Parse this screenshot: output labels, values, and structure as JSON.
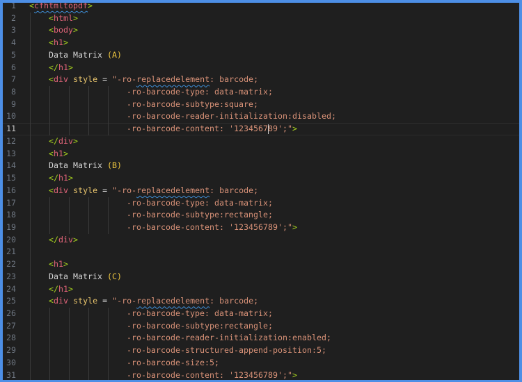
{
  "editor": {
    "current_line": 11,
    "cursor_after_text": "-ro-barcode-content: '1234567",
    "colors": {
      "border": "#4d8fe6",
      "background": "#1f1f1f",
      "bracket": "#a6d11f",
      "tag": "#e2657a",
      "attribute": "#e8c46c",
      "string": "#d99278",
      "text": "#d4d4d4",
      "paren": "#f2c940"
    },
    "lines": [
      {
        "n": "1",
        "tokens": [
          [
            "p",
            "<"
          ],
          [
            "t warn",
            "cfhtmltopdf"
          ],
          [
            "p",
            ">"
          ]
        ]
      },
      {
        "n": "2",
        "tokens": [
          [
            "x",
            "    "
          ],
          [
            "p",
            "<"
          ],
          [
            "t",
            "html"
          ],
          [
            "p",
            ">"
          ]
        ]
      },
      {
        "n": "3",
        "tokens": [
          [
            "x",
            "    "
          ],
          [
            "p",
            "<"
          ],
          [
            "t",
            "body"
          ],
          [
            "p",
            ">"
          ]
        ]
      },
      {
        "n": "4",
        "tokens": [
          [
            "x",
            "    "
          ],
          [
            "p",
            "<"
          ],
          [
            "t",
            "h1"
          ],
          [
            "p",
            ">"
          ]
        ]
      },
      {
        "n": "5",
        "tokens": [
          [
            "x",
            "    Data Matrix "
          ],
          [
            "b",
            "(A)"
          ]
        ]
      },
      {
        "n": "6",
        "tokens": [
          [
            "x",
            "    "
          ],
          [
            "p",
            "</"
          ],
          [
            "t",
            "h1"
          ],
          [
            "p",
            ">"
          ]
        ]
      },
      {
        "n": "7",
        "tokens": [
          [
            "x",
            "    "
          ],
          [
            "p",
            "<"
          ],
          [
            "t",
            "div"
          ],
          [
            "x",
            " "
          ],
          [
            "a",
            "style"
          ],
          [
            "o",
            " = "
          ],
          [
            "s",
            "\"-ro-"
          ],
          [
            "s warn",
            "replacedelement"
          ],
          [
            "s",
            ": barcode;"
          ]
        ]
      },
      {
        "n": "8",
        "tokens": [
          [
            "x",
            "                    "
          ],
          [
            "s",
            "-ro-barcode-type: data-matrix;"
          ]
        ]
      },
      {
        "n": "9",
        "tokens": [
          [
            "x",
            "                    "
          ],
          [
            "s",
            "-ro-barcode-subtype:square;"
          ]
        ]
      },
      {
        "n": "10",
        "tokens": [
          [
            "x",
            "                    "
          ],
          [
            "s",
            "-ro-barcode-reader-initialization:disabled;"
          ]
        ]
      },
      {
        "n": "11",
        "tokens": [
          [
            "x",
            "                    "
          ],
          [
            "s",
            "-ro-barcode-content: '1234567"
          ],
          [
            "cursor",
            ""
          ],
          [
            "s",
            "89';\""
          ],
          [
            "p",
            ">"
          ]
        ]
      },
      {
        "n": "12",
        "tokens": [
          [
            "x",
            "    "
          ],
          [
            "p",
            "</"
          ],
          [
            "t",
            "div"
          ],
          [
            "p",
            ">"
          ]
        ]
      },
      {
        "n": "13",
        "tokens": [
          [
            "x",
            "    "
          ],
          [
            "p",
            "<"
          ],
          [
            "t",
            "h1"
          ],
          [
            "p",
            ">"
          ]
        ]
      },
      {
        "n": "14",
        "tokens": [
          [
            "x",
            "    Data Matrix "
          ],
          [
            "b",
            "(B)"
          ]
        ]
      },
      {
        "n": "15",
        "tokens": [
          [
            "x",
            "    "
          ],
          [
            "p",
            "</"
          ],
          [
            "t",
            "h1"
          ],
          [
            "p",
            ">"
          ]
        ]
      },
      {
        "n": "16",
        "tokens": [
          [
            "x",
            "    "
          ],
          [
            "p",
            "<"
          ],
          [
            "t",
            "div"
          ],
          [
            "x",
            " "
          ],
          [
            "a",
            "style"
          ],
          [
            "o",
            " = "
          ],
          [
            "s",
            "\"-ro-"
          ],
          [
            "s warn",
            "replacedelement"
          ],
          [
            "s",
            ": barcode;"
          ]
        ]
      },
      {
        "n": "17",
        "tokens": [
          [
            "x",
            "                    "
          ],
          [
            "s",
            "-ro-barcode-type: data-matrix;"
          ]
        ]
      },
      {
        "n": "18",
        "tokens": [
          [
            "x",
            "                    "
          ],
          [
            "s",
            "-ro-barcode-subtype:rectangle;"
          ]
        ]
      },
      {
        "n": "19",
        "tokens": [
          [
            "x",
            "                    "
          ],
          [
            "s",
            "-ro-barcode-content: '123456789';\""
          ],
          [
            "p",
            ">"
          ]
        ]
      },
      {
        "n": "20",
        "tokens": [
          [
            "x",
            "    "
          ],
          [
            "p",
            "</"
          ],
          [
            "t",
            "div"
          ],
          [
            "p",
            ">"
          ]
        ]
      },
      {
        "n": "21",
        "tokens": [
          [
            "x",
            "    "
          ]
        ]
      },
      {
        "n": "22",
        "tokens": [
          [
            "x",
            "    "
          ],
          [
            "p",
            "<"
          ],
          [
            "t",
            "h1"
          ],
          [
            "p",
            ">"
          ]
        ]
      },
      {
        "n": "23",
        "tokens": [
          [
            "x",
            "    Data Matrix "
          ],
          [
            "b",
            "(C)"
          ]
        ]
      },
      {
        "n": "24",
        "tokens": [
          [
            "x",
            "    "
          ],
          [
            "p",
            "</"
          ],
          [
            "t",
            "h1"
          ],
          [
            "p",
            ">"
          ]
        ]
      },
      {
        "n": "25",
        "tokens": [
          [
            "x",
            "    "
          ],
          [
            "p",
            "<"
          ],
          [
            "t",
            "div"
          ],
          [
            "x",
            " "
          ],
          [
            "a",
            "style"
          ],
          [
            "o",
            " = "
          ],
          [
            "s",
            "\"-ro-"
          ],
          [
            "s warn",
            "replacedelement"
          ],
          [
            "s",
            ": barcode;"
          ]
        ]
      },
      {
        "n": "26",
        "tokens": [
          [
            "x",
            "                    "
          ],
          [
            "s",
            "-ro-barcode-type: data-matrix;"
          ]
        ]
      },
      {
        "n": "27",
        "tokens": [
          [
            "x",
            "                    "
          ],
          [
            "s",
            "-ro-barcode-subtype:rectangle;"
          ]
        ]
      },
      {
        "n": "28",
        "tokens": [
          [
            "x",
            "                    "
          ],
          [
            "s",
            "-ro-barcode-reader-initialization:enabled;"
          ]
        ]
      },
      {
        "n": "29",
        "tokens": [
          [
            "x",
            "                    "
          ],
          [
            "s",
            "-ro-barcode-structured-append-position:5;"
          ]
        ]
      },
      {
        "n": "30",
        "tokens": [
          [
            "x",
            "                    "
          ],
          [
            "s",
            "-ro-barcode-size:5;"
          ]
        ]
      },
      {
        "n": "31",
        "tokens": [
          [
            "x",
            "                    "
          ],
          [
            "s",
            "-ro-barcode-content: '123456789';\""
          ],
          [
            "p",
            ">"
          ]
        ]
      }
    ]
  }
}
